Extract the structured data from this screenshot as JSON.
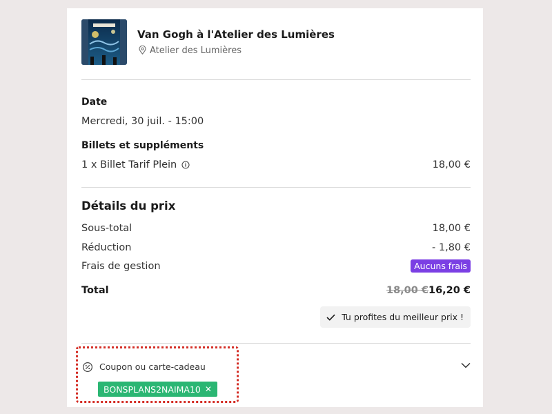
{
  "event": {
    "title": "Van Gogh à l'Atelier des Lumières",
    "venue": "Atelier des Lumières",
    "thumb_text": "Van Gogh"
  },
  "date": {
    "label": "Date",
    "value": "Mercredi, 30 juil. - 15:00"
  },
  "tickets": {
    "label": "Billets et suppléments",
    "item": "1 x Billet Tarif Plein",
    "price": "18,00 €"
  },
  "price_details": {
    "heading": "Détails du prix",
    "subtotal_label": "Sous-total",
    "subtotal_value": "18,00 €",
    "discount_label": "Réduction",
    "discount_value": "- 1,80 €",
    "fees_label": "Frais de gestion",
    "fees_badge": "Aucuns frais",
    "total_label": "Total",
    "total_old": "18,00 €",
    "total_new": "16,20 €",
    "best_price_note": "Tu profites du meilleur prix !"
  },
  "coupon": {
    "label": "Coupon ou carte-cadeau",
    "code": "BONSPLANS2NAIMA10",
    "remove_symbol": "✕"
  },
  "colors": {
    "badge": "#7b3fe4",
    "coupon_tag": "#2bb673",
    "highlight": "#d42e26",
    "background": "#ede8e8"
  },
  "icons": [
    "location-pin-icon",
    "info-icon",
    "checkmark-icon",
    "coupon-icon",
    "chevron-down-icon",
    "remove-icon"
  ]
}
